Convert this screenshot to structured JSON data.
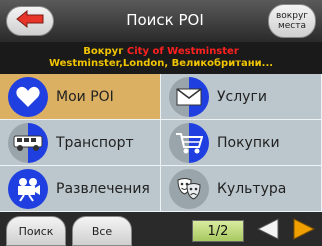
{
  "header": {
    "title": "Поиск POI",
    "nearby_line1": "вокруг",
    "nearby_line2": "места",
    "back_icon": "back-arrow-icon"
  },
  "location": {
    "prefix": "Вокруг",
    "city": "City of Westminster",
    "address": "Westminster,London, Великобритани..."
  },
  "categories": [
    {
      "label": "Мои POI",
      "icon": "heart-icon",
      "selected": true
    },
    {
      "label": "Услуги",
      "icon": "envelope-icon",
      "selected": false
    },
    {
      "label": "Транспорт",
      "icon": "bus-icon",
      "selected": false
    },
    {
      "label": "Покупки",
      "icon": "shopping-cart-icon",
      "selected": false
    },
    {
      "label": "Развлечения",
      "icon": "camera-icon",
      "selected": false
    },
    {
      "label": "Культура",
      "icon": "theater-masks-icon",
      "selected": false
    }
  ],
  "footer": {
    "search_label": "Поиск",
    "all_label": "Все",
    "page_indicator": "1/2"
  },
  "colors": {
    "accent_orange": "#f0a000",
    "selected_bg": "#dcb063",
    "grid_bg": "#bcc7cd",
    "icon_blue": "#1f3fe0",
    "location_yellow": "#f0c400",
    "location_red": "#ff2020"
  }
}
